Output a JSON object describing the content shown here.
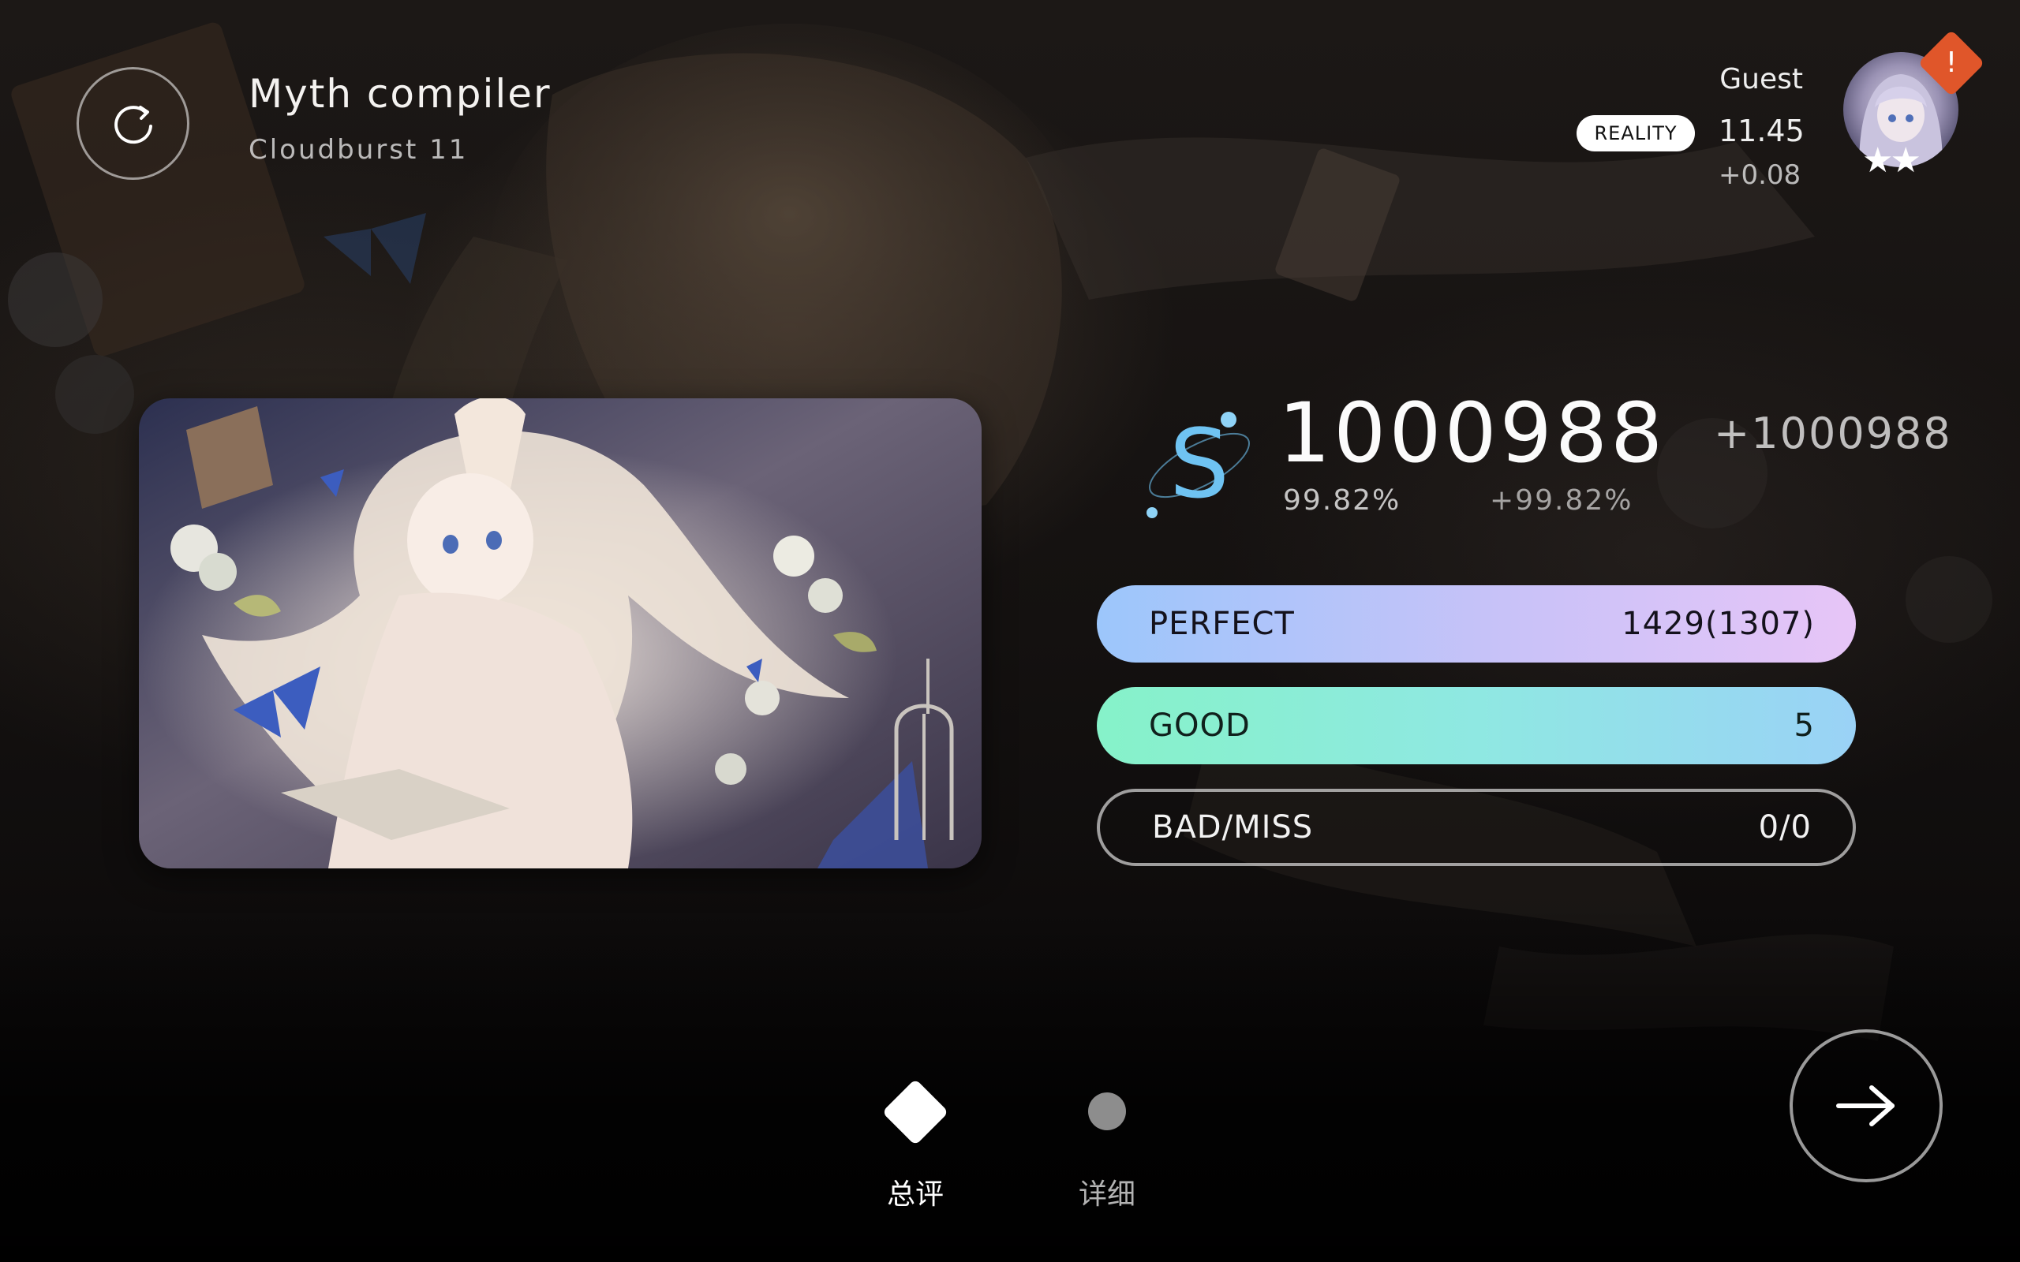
{
  "song": {
    "title": "Myth compiler",
    "level": "Cloudburst 11"
  },
  "player": {
    "name": "Guest",
    "badge": "REALITY",
    "rks": "11.45",
    "rks_delta": "+0.08",
    "avatar_stars": "★★",
    "notice_mark": "!"
  },
  "result": {
    "rank": "S",
    "score": "1000988",
    "score_delta": "+1000988",
    "accuracy": "99.82%",
    "accuracy_delta": "+99.82%"
  },
  "judgements": {
    "perfect": {
      "label": "PERFECT",
      "value": "1429(1307)"
    },
    "good": {
      "label": "GOOD",
      "value": "5"
    },
    "miss": {
      "label": "BAD/MISS",
      "value": "0/0"
    }
  },
  "tabs": {
    "summary": "总评",
    "detail": "详细"
  },
  "icons": {
    "retry": "retry-icon",
    "next": "arrow-right-icon"
  },
  "colors": {
    "rank_accent": "#6fc3f2",
    "perfect_start": "#9cc6fb",
    "perfect_end": "#e7c5f7",
    "good_start": "#86f2c9",
    "good_end": "#9ad2f6",
    "notice": "#e0562a"
  }
}
